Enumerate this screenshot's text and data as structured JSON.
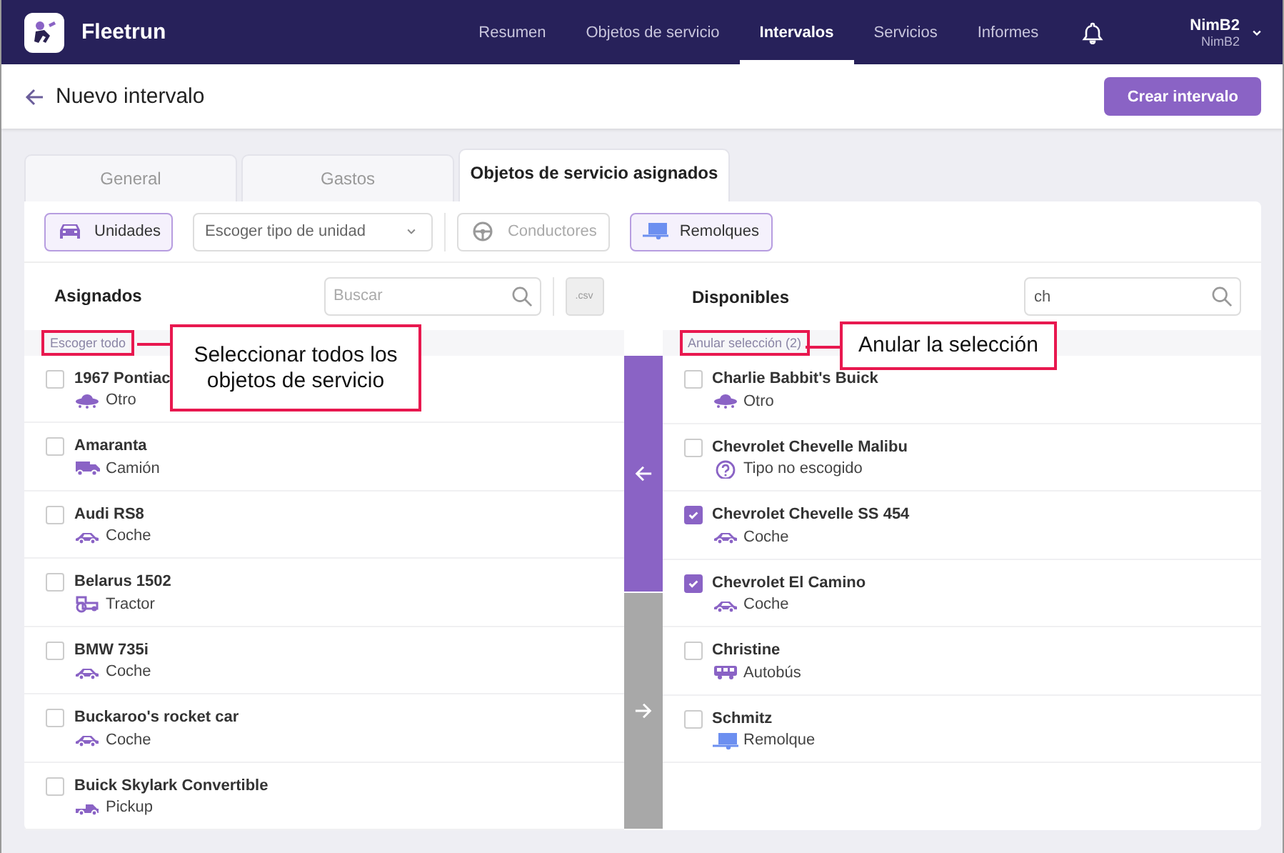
{
  "app": {
    "name": "Fleetrun"
  },
  "nav": [
    {
      "label": "Resumen",
      "selected": false
    },
    {
      "label": "Objetos de servicio",
      "selected": false
    },
    {
      "label": "Intervalos",
      "selected": true
    },
    {
      "label": "Servicios",
      "selected": false
    },
    {
      "label": "Informes",
      "selected": false
    }
  ],
  "user": {
    "name": "NimB2",
    "account": "NimB2"
  },
  "page": {
    "title": "Nuevo intervalo",
    "action": "Crear intervalo"
  },
  "tabs": [
    {
      "label": "General",
      "selected": false
    },
    {
      "label": "Gastos",
      "selected": false
    },
    {
      "label": "Objetos de servicio asignados",
      "selected": true
    }
  ],
  "filters": [
    {
      "kind": "units",
      "label": "Unidades",
      "selected": true
    },
    {
      "kind": "dropdown",
      "placeholder": "Escoger tipo de unidad"
    },
    {
      "kind": "drivers",
      "label": "Conductores",
      "selected": false
    },
    {
      "kind": "trailers",
      "label": "Remolques",
      "selected": true
    }
  ],
  "assigned": {
    "title": "Asignados",
    "search": {
      "placeholder": "Buscar"
    },
    "export": ".csv",
    "select_link": "Escoger todo",
    "highlighted": true,
    "items": [
      {
        "name": "1967 Pontiac",
        "type": "Otro",
        "kind": "other",
        "checked": false
      },
      {
        "name": "Amaranta",
        "type": "Camión",
        "kind": "truck",
        "checked": false
      },
      {
        "name": "Audi RS8",
        "type": "Coche",
        "kind": "car",
        "checked": false
      },
      {
        "name": "Belarus 1502",
        "type": "Tractor",
        "kind": "tractor",
        "checked": false
      },
      {
        "name": "BMW 735i",
        "type": "Coche",
        "kind": "car",
        "checked": false
      },
      {
        "name": "Buckaroo's rocket car",
        "type": "Coche",
        "kind": "car",
        "checked": false
      },
      {
        "name": "Buick Skylark Convertible",
        "type": "Pickup",
        "kind": "pickup",
        "checked": false
      }
    ]
  },
  "transfer": [
    {
      "kind": "left",
      "disabled": false
    },
    {
      "kind": "right",
      "disabled": true
    }
  ],
  "available": {
    "title": "Disponibles",
    "search": {
      "value": "ch"
    },
    "select_link": "Anular selección (2)",
    "highlighted": true,
    "items": [
      {
        "name": "Charlie Babbit's Buick",
        "type": "Otro",
        "kind": "other",
        "checked": false
      },
      {
        "name": "Chevrolet Chevelle Malibu",
        "type": "Tipo no escogido",
        "kind": "unknown",
        "checked": false
      },
      {
        "name": "Chevrolet Chevelle SS 454",
        "type": "Coche",
        "kind": "car",
        "checked": true
      },
      {
        "name": "Chevrolet El Camino",
        "type": "Coche",
        "kind": "car",
        "checked": true
      },
      {
        "name": "Christine",
        "type": "Autobús",
        "kind": "bus",
        "checked": false
      },
      {
        "name": "Schmitz",
        "type": "Remolque",
        "kind": "trailer",
        "checked": false
      }
    ]
  },
  "annotations": [
    {
      "text": "Seleccionar todos los objetos de servicio"
    },
    {
      "text": "Anular la selección"
    }
  ]
}
